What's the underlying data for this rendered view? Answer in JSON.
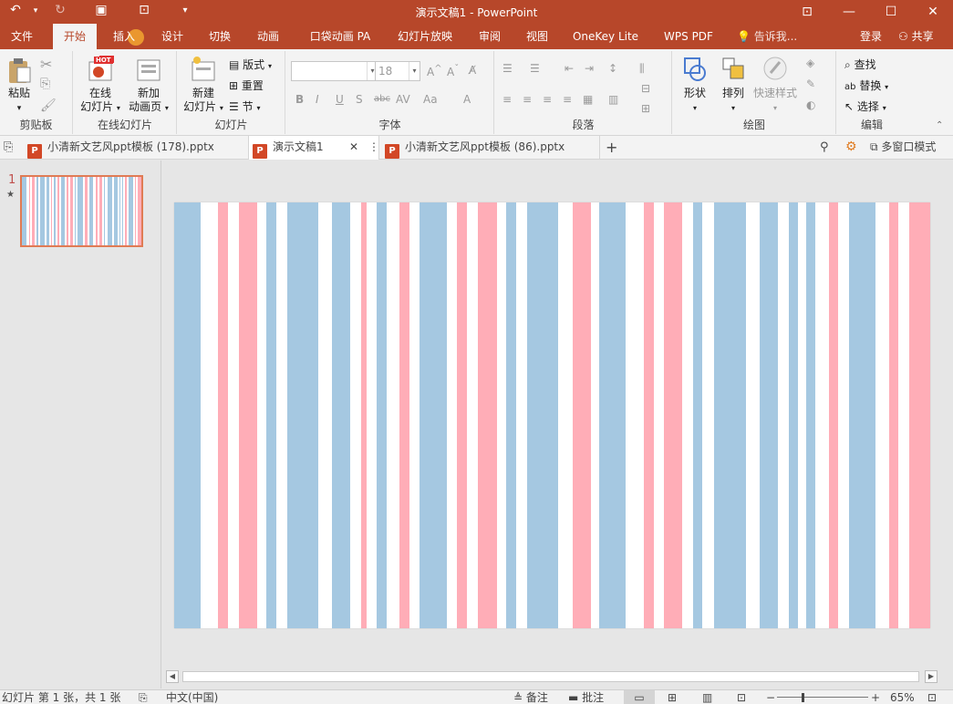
{
  "window": {
    "title": "演示文稿1 - PowerPoint",
    "quick_access": [
      "undo-icon",
      "redo-icon",
      "save-icon",
      "present-icon",
      "customize-icon"
    ]
  },
  "tabs": {
    "file": "文件",
    "home": "开始",
    "insert": "插入",
    "design": "设计",
    "transitions": "切换",
    "animations": "动画",
    "pocket_animation": "口袋动画 PA",
    "slideshow": "幻灯片放映",
    "review": "审阅",
    "view": "视图",
    "onekey": "OneKey Lite",
    "wps_pdf": "WPS PDF",
    "tell_me": "告诉我...",
    "login": "登录",
    "share": "共享",
    "active": "开始"
  },
  "ribbon": {
    "clipboard": {
      "label": "剪贴板",
      "paste": "粘贴"
    },
    "online": {
      "label": "在线幻灯片",
      "online_slide_1": "在线",
      "online_slide_2": "幻灯片",
      "hot_badge": "HOT",
      "new_anim_1": "新加",
      "new_anim_2": "动画页"
    },
    "slides": {
      "label": "幻灯片",
      "new_slide_1": "新建",
      "new_slide_2": "幻灯片",
      "layout": "版式",
      "reset": "重置",
      "section": "节"
    },
    "font": {
      "label": "字体",
      "font_name": "",
      "font_size": "18"
    },
    "paragraph": {
      "label": "段落"
    },
    "drawing": {
      "label": "绘图",
      "shapes": "形状",
      "arrange": "排列",
      "quick_styles": "快速样式"
    },
    "editing": {
      "label": "编辑",
      "find": "查找",
      "replace": "替换",
      "select": "选择"
    }
  },
  "doc_tabs": [
    {
      "name": "小清新文艺风ppt模板 (178).pptx",
      "active": false
    },
    {
      "name": "演示文稿1",
      "active": true
    },
    {
      "name": "小清新文艺风ppt模板 (86).pptx",
      "active": false
    }
  ],
  "doc_tabs_right": {
    "multi_window": "多窗口模式"
  },
  "thumbnails": {
    "slide_number": "1",
    "star": "★"
  },
  "colors": {
    "accent": "#b7472a",
    "stripe_blue": "#a5c8e1",
    "stripe_pink": "#ffadb7",
    "stripe_white": "#ffffff"
  },
  "status": {
    "slide_info": "幻灯片 第 1 张，共 1 张",
    "language": "中文(中国)",
    "notes": "备注",
    "comments": "批注",
    "zoom": "65%"
  }
}
